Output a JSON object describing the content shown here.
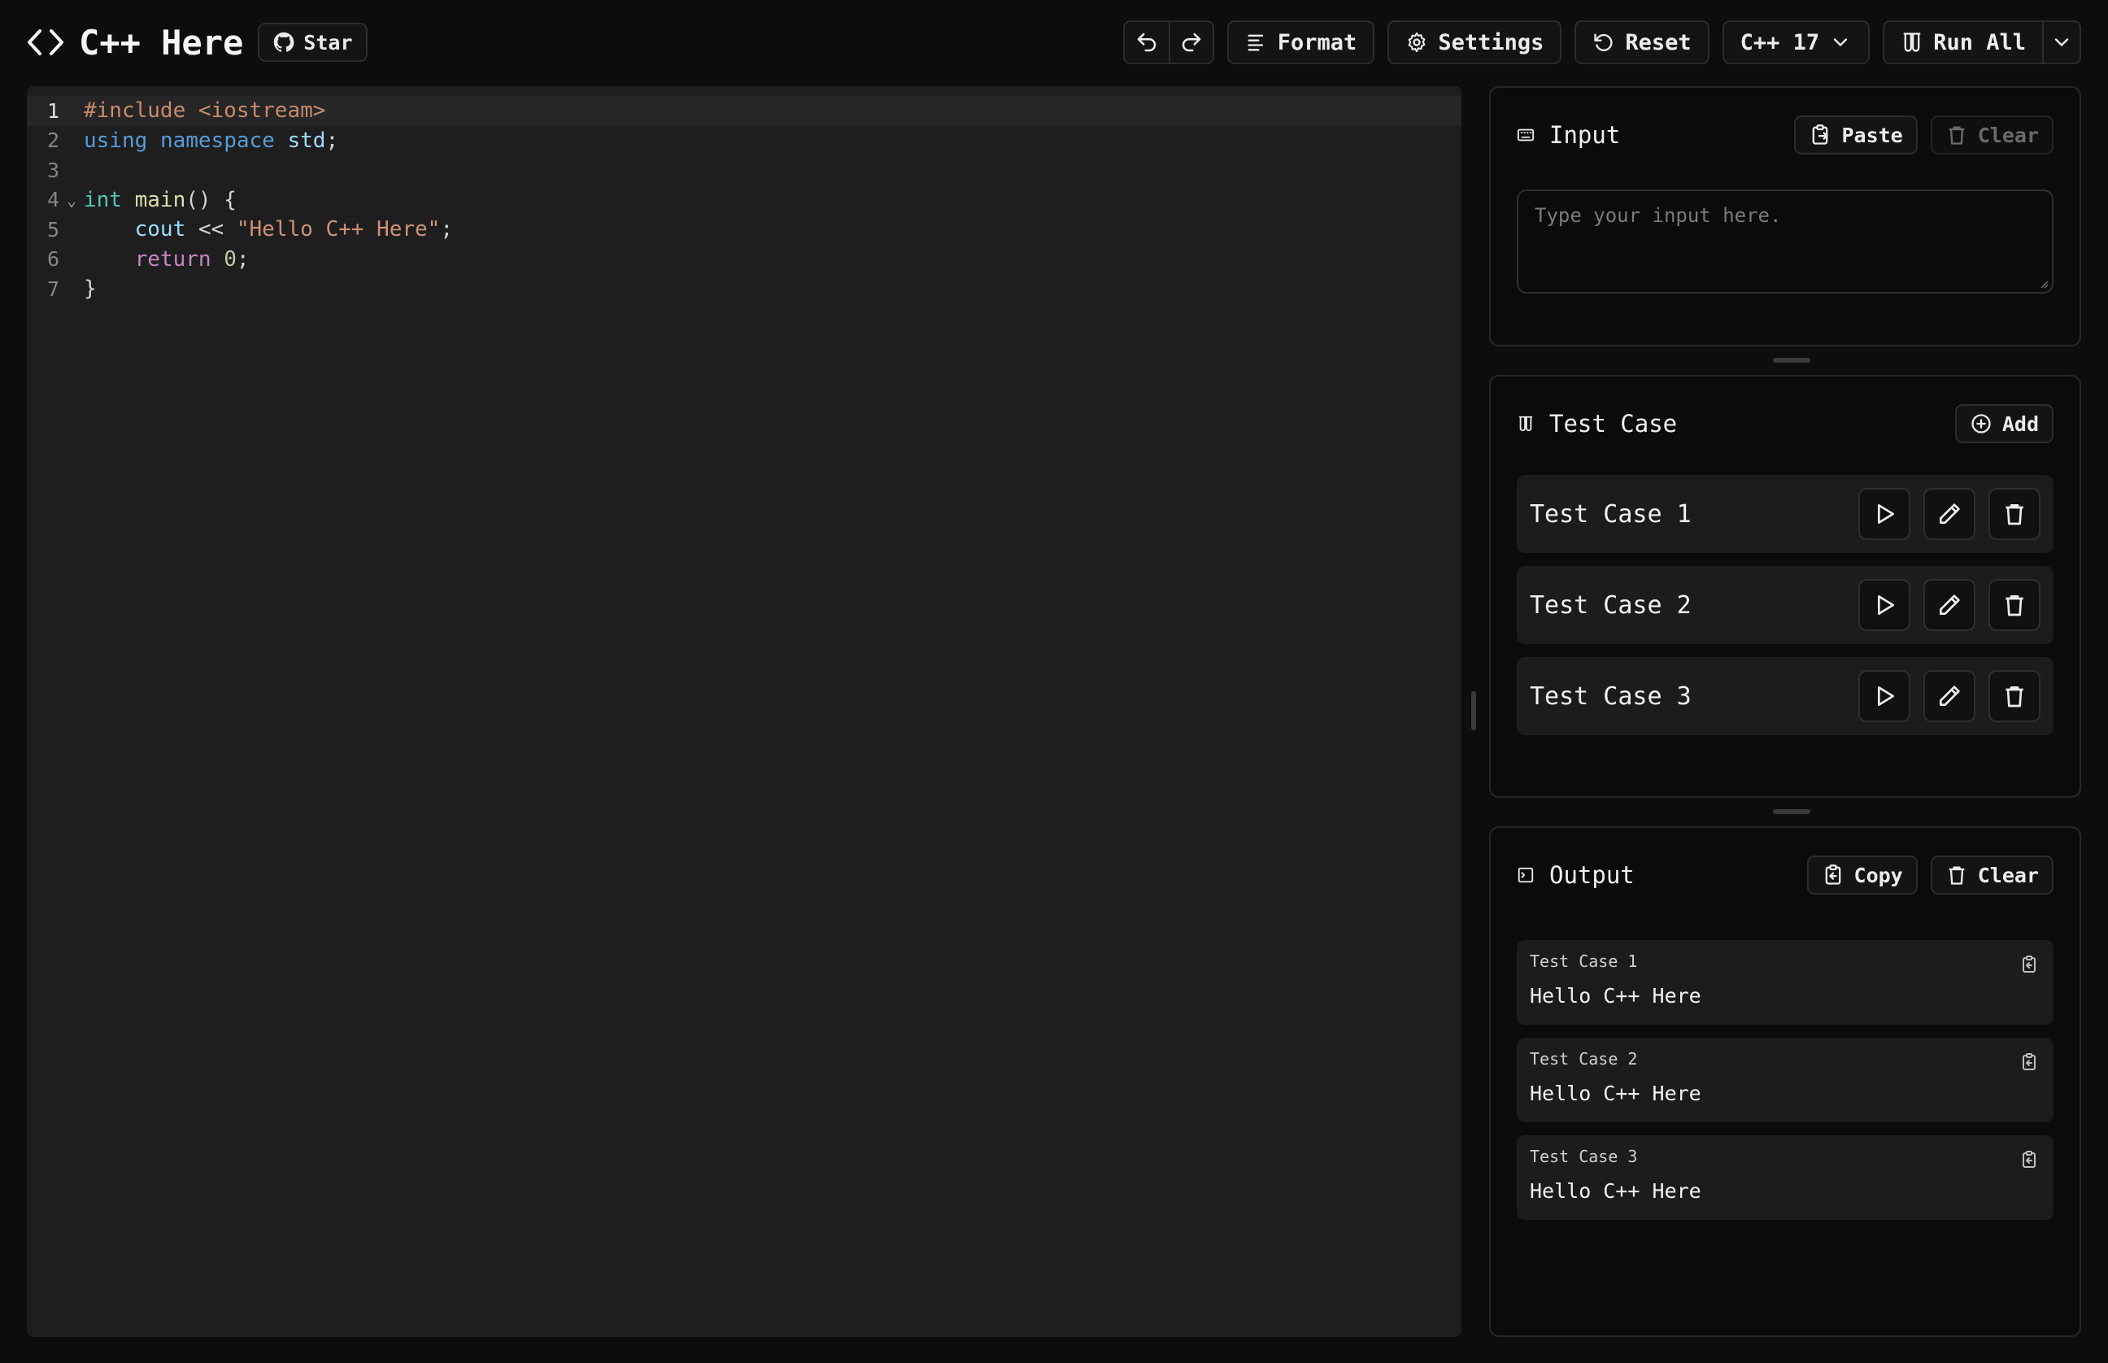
{
  "header": {
    "app_title": "C++ Here",
    "star_label": "Star",
    "format_label": "Format",
    "settings_label": "Settings",
    "reset_label": "Reset",
    "language_label": "C++ 17",
    "run_all_label": "Run All"
  },
  "editor": {
    "lines": [
      {
        "num": "1"
      },
      {
        "num": "2"
      },
      {
        "num": "3"
      },
      {
        "num": "4"
      },
      {
        "num": "5"
      },
      {
        "num": "6"
      },
      {
        "num": "7"
      }
    ],
    "code": {
      "l1_pre": "#include <iostream>",
      "l2_kw1": "using",
      "l2_kw2": "namespace",
      "l2_id": "std",
      "l2_semi": ";",
      "l4_type": "int",
      "l4_fn": "main",
      "l4_rest": "() {",
      "l5_var": "cout",
      "l5_op": " << ",
      "l5_str": "\"Hello C++ Here\"",
      "l5_semi": ";",
      "l6_kw": "return",
      "l6_num": "0",
      "l6_semi": ";",
      "l7_brace": "}"
    }
  },
  "input_panel": {
    "title": "Input",
    "paste_label": "Paste",
    "clear_label": "Clear",
    "placeholder": "Type your input here."
  },
  "testcase_panel": {
    "title": "Test Case",
    "add_label": "Add",
    "items": [
      {
        "label": "Test Case 1"
      },
      {
        "label": "Test Case 2"
      },
      {
        "label": "Test Case 3"
      }
    ]
  },
  "output_panel": {
    "title": "Output",
    "copy_label": "Copy",
    "clear_label": "Clear",
    "results": [
      {
        "label": "Test Case 1",
        "value": "Hello C++ Here"
      },
      {
        "label": "Test Case 2",
        "value": "Hello C++ Here"
      },
      {
        "label": "Test Case 3",
        "value": "Hello C++ Here"
      }
    ]
  },
  "icons": {
    "brand": "code-brackets-icon",
    "star": "github-icon",
    "undo": "undo-icon",
    "redo": "redo-icon",
    "format": "align-left-icon",
    "settings": "gear-icon",
    "reset": "rotate-ccw-icon",
    "language_dropdown": "chevron-down-icon",
    "run_all": "flask-icon",
    "input": "keyboard-icon",
    "paste": "clipboard-paste-icon",
    "clear": "trash-icon",
    "testcase": "flask-icon",
    "add": "plus-circle-icon",
    "run": "play-icon",
    "edit": "pencil-icon",
    "delete": "trash-icon",
    "output": "terminal-icon",
    "copy": "clipboard-copy-icon"
  },
  "colors": {
    "background": "#0d0d0d",
    "editor_bg": "#1e1e1e",
    "keyword": "#569cd6",
    "type": "#4ec9b0",
    "function": "#dcdcaa",
    "string": "#ce9178",
    "preprocessor": "#c98a6b",
    "control": "#c586c0",
    "number": "#b5cea8"
  }
}
